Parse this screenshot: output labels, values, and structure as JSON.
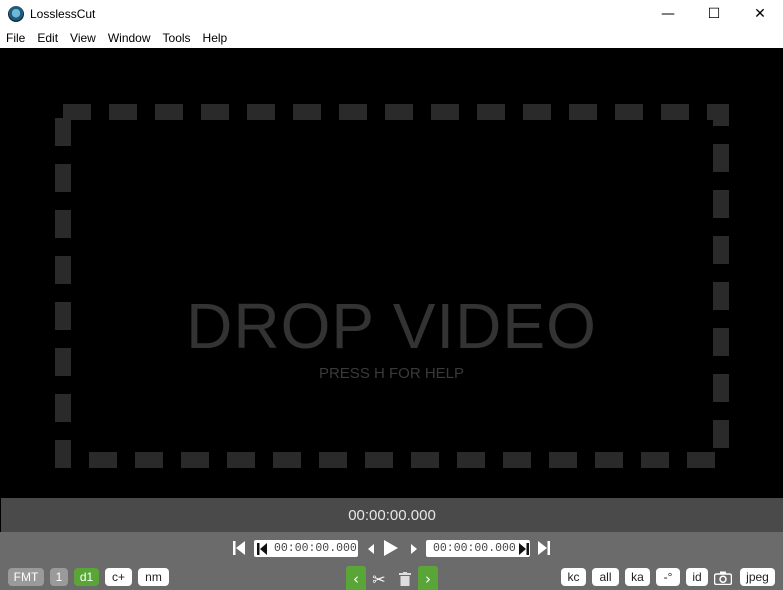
{
  "window": {
    "title": "LosslessCut",
    "minimize": "—",
    "maximize": "☐",
    "close": "✕"
  },
  "menu": [
    "File",
    "Edit",
    "View",
    "Window",
    "Tools",
    "Help"
  ],
  "drop_zone": {
    "title": "DROP VIDEO",
    "hint": "PRESS H FOR HELP",
    "frame_color": "#2a2a2a"
  },
  "timeline": {
    "current_time": "00:00:00.000"
  },
  "playback": {
    "cut_start_time": "00:00:00.000",
    "cut_end_time": "00:00:00.000"
  },
  "left_buttons": {
    "fmt": "FMT",
    "one": "1",
    "d1": "d1",
    "c_plus": "c+",
    "nm": "nm"
  },
  "right_buttons": {
    "kc": "kc",
    "all": "all",
    "ka": "ka",
    "rotate": "-°",
    "id": "id",
    "jpeg": "jpeg"
  },
  "colors": {
    "accent_green": "#5aa538",
    "timebar_bg": "#4a4a4a",
    "controls_bg": "#6b6b6b"
  }
}
